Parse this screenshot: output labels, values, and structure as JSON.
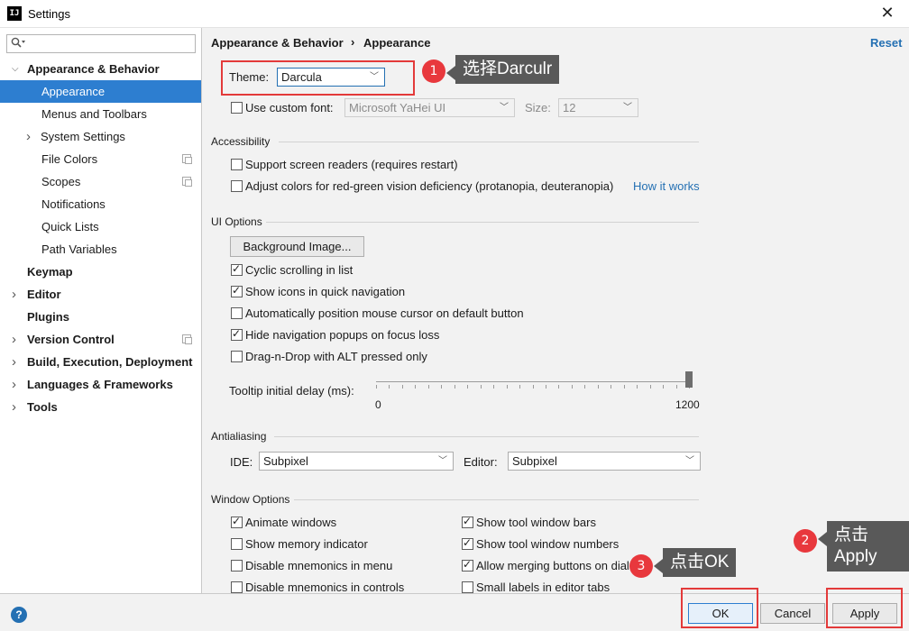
{
  "window": {
    "title": "Settings",
    "app_icon_text": "IJ",
    "close_glyph": "✕"
  },
  "search": {
    "placeholder": "",
    "icon": "search-icon"
  },
  "sidebar": {
    "items": [
      {
        "label": "Appearance & Behavior",
        "bold": true,
        "expanded": true
      },
      {
        "label": "Appearance",
        "selected": true
      },
      {
        "label": "Menus and Toolbars"
      },
      {
        "label": "System Settings",
        "has_arrow": true
      },
      {
        "label": "File Colors",
        "copy_icon": true
      },
      {
        "label": "Scopes",
        "copy_icon": true
      },
      {
        "label": "Notifications"
      },
      {
        "label": "Quick Lists"
      },
      {
        "label": "Path Variables"
      },
      {
        "label": "Keymap",
        "bold": true
      },
      {
        "label": "Editor",
        "bold": true,
        "has_arrow": true
      },
      {
        "label": "Plugins",
        "bold": true
      },
      {
        "label": "Version Control",
        "bold": true,
        "has_arrow": true,
        "copy_icon": true
      },
      {
        "label": "Build, Execution, Deployment",
        "bold": true,
        "has_arrow": true
      },
      {
        "label": "Languages & Frameworks",
        "bold": true,
        "has_arrow": true
      },
      {
        "label": "Tools",
        "bold": true,
        "has_arrow": true
      }
    ]
  },
  "header": {
    "breadcrumb_parent": "Appearance & Behavior",
    "breadcrumb_sep": "›",
    "breadcrumb_current": "Appearance",
    "reset": "Reset"
  },
  "theme": {
    "label": "Theme:",
    "value": "Darcula"
  },
  "font": {
    "label": "Use custom font:",
    "checked": false,
    "family_value": "Microsoft YaHei UI",
    "size_label": "Size:",
    "size_value": "12"
  },
  "accessibility": {
    "title": "Accessibility",
    "screen_readers": {
      "label": "Support screen readers (requires restart)",
      "checked": false
    },
    "red_green": {
      "label": "Adjust colors for red-green vision deficiency (protanopia, deuteranopia)",
      "checked": false
    },
    "how_it_works": "How it works"
  },
  "ui_options": {
    "title": "UI Options",
    "bg_button": "Background Image...",
    "checkboxes": [
      {
        "label": "Cyclic scrolling in list",
        "checked": true
      },
      {
        "label": "Show icons in quick navigation",
        "checked": true
      },
      {
        "label": "Automatically position mouse cursor on default button",
        "checked": false
      },
      {
        "label": "Hide navigation popups on focus loss",
        "checked": true
      },
      {
        "label": "Drag-n-Drop with ALT pressed only",
        "checked": false
      }
    ],
    "tooltip_label": "Tooltip initial delay (ms):",
    "slider_min": "0",
    "slider_max": "1200",
    "slider_value": 1200
  },
  "antialiasing": {
    "title": "Antialiasing",
    "ide_label": "IDE:",
    "ide_value": "Subpixel",
    "editor_label": "Editor:",
    "editor_value": "Subpixel"
  },
  "window_options": {
    "title": "Window Options",
    "left": [
      {
        "label": "Animate windows",
        "checked": true
      },
      {
        "label": "Show memory indicator",
        "checked": false
      },
      {
        "label": "Disable mnemonics in menu",
        "checked": false
      },
      {
        "label": "Disable mnemonics in controls",
        "checked": false
      }
    ],
    "right": [
      {
        "label": "Show tool window bars",
        "checked": true
      },
      {
        "label": "Show tool window numbers",
        "checked": true
      },
      {
        "label": "Allow merging buttons on dialogs",
        "checked": true
      },
      {
        "label": "Small labels in editor tabs",
        "checked": false
      }
    ]
  },
  "annotations": {
    "step1_num": "1",
    "step1_text": "选择Darculr",
    "step2_num": "2",
    "step2_line1": "点击",
    "step2_line2": "Apply",
    "step3_num": "3",
    "step3_text": "点击OK"
  },
  "buttons": {
    "ok": "OK",
    "cancel": "Cancel",
    "apply": "Apply",
    "help": "?"
  },
  "colors": {
    "accent": "#2d7ed0",
    "annotation_red": "#e33a3a",
    "link": "#2470b3"
  }
}
